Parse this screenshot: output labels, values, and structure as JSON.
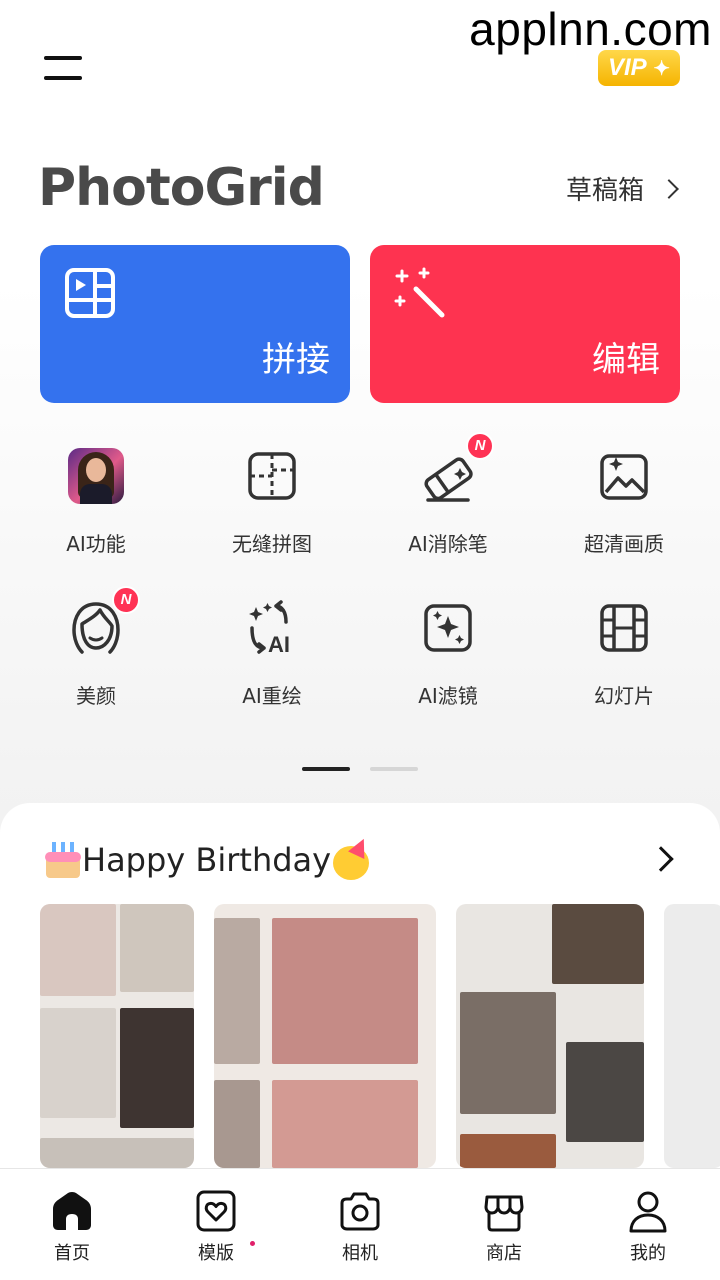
{
  "header": {
    "watermark": "applnn.com",
    "vip_label": "VIP",
    "vip_color": "#f5b400"
  },
  "brand": {
    "title": "PhotoGrid",
    "drafts_label": "草稿箱"
  },
  "main_actions": [
    {
      "label": "拼接",
      "icon": "collage-layout-icon",
      "color": "#3472ee"
    },
    {
      "label": "编辑",
      "icon": "magic-wand-icon",
      "color": "#fe3350"
    }
  ],
  "tools": [
    {
      "label": "AI功能",
      "icon": "ai-portrait-thumbnail"
    },
    {
      "label": "无缝拼图",
      "icon": "seamless-grid-icon"
    },
    {
      "label": "AI消除笔",
      "icon": "eraser-icon",
      "badge": "N"
    },
    {
      "label": "超清画质",
      "icon": "hd-image-icon"
    },
    {
      "label": "美颜",
      "icon": "beauty-face-icon",
      "badge": "N"
    },
    {
      "label": "AI重绘",
      "icon": "ai-redraw-icon"
    },
    {
      "label": "AI滤镜",
      "icon": "ai-filter-icon"
    },
    {
      "label": "幻灯片",
      "icon": "film-strip-icon"
    }
  ],
  "pager": {
    "pages": 2,
    "active": 1
  },
  "section": {
    "title": "Happy Birthday",
    "leading_emoji": "birthday-cake-icon",
    "trailing_emoji": "party-face-icon"
  },
  "bottom_nav": [
    {
      "label": "首页",
      "icon": "home-icon",
      "active": true
    },
    {
      "label": "模版",
      "icon": "template-heart-icon"
    },
    {
      "label": "相机",
      "icon": "camera-icon"
    },
    {
      "label": "商店",
      "icon": "store-icon"
    },
    {
      "label": "我的",
      "icon": "profile-icon"
    }
  ]
}
